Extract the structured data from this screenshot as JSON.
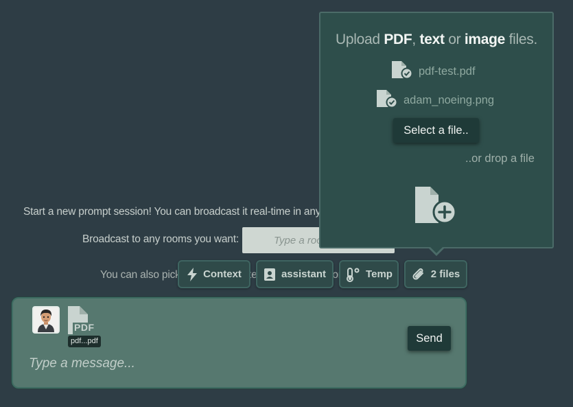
{
  "session": {
    "intro": "Start a new prompt session! You can broadcast it real-time in any room you want.",
    "broadcast_label": "Broadcast to any rooms you want:",
    "broadcast_placeholder": "Type a room name...",
    "also_text": "You can also pick a role, model, temperature and context."
  },
  "toolbar": {
    "context_label": "Context",
    "role_label": "assistant",
    "temp_label": "Temp",
    "files_label": "2 files"
  },
  "upload": {
    "title_upload": "Upload",
    "title_pdf": "PDF",
    "title_comma": ",",
    "title_text": "text",
    "title_or": "or",
    "title_image": "image",
    "title_files": "files.",
    "files": [
      "pdf-test.pdf",
      "adam_noeing.png"
    ],
    "select_label": "Select a file..",
    "drop_label": "..or drop a file"
  },
  "composer": {
    "attachment_badge": "PDF",
    "attachment_tooltip": "pdf...pdf",
    "send_label": "Send",
    "message_placeholder": "Type a message..."
  },
  "colors": {
    "background": "#2e3d45",
    "popover": "#2e4e4b",
    "composer": "#56786f",
    "button_dark": "#1f3a38"
  }
}
